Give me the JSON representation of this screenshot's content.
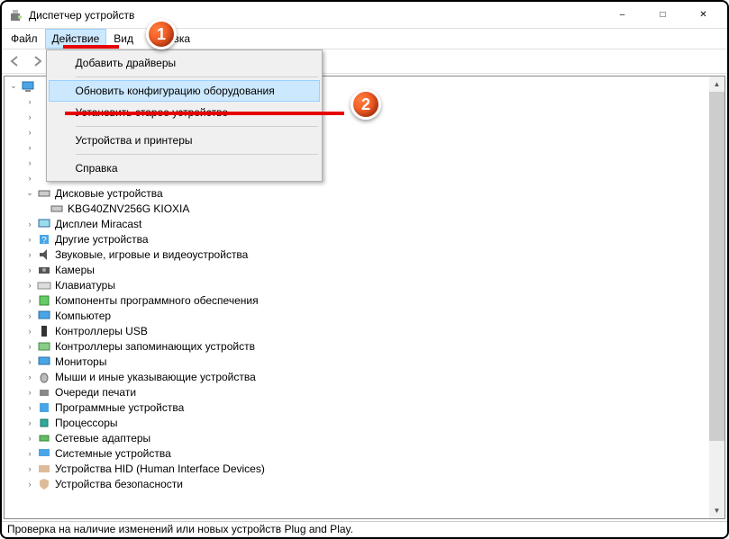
{
  "window": {
    "title": "Диспетчер устройств"
  },
  "menubar": {
    "file": "Файл",
    "action": "Действие",
    "view": "Вид",
    "help": "Справка"
  },
  "dropdown": {
    "add_drivers": "Добавить драйверы",
    "scan": "Обновить конфигурацию оборудования",
    "add_legacy": "Установить старое устройство",
    "devices_printers": "Устройства и принтеры",
    "help": "Справка"
  },
  "tree": {
    "disk_drives": "Дисковые устройства",
    "disk_item": "KBG40ZNV256G KIOXIA",
    "miracast": "Дисплеи Miracast",
    "other": "Другие устройства",
    "audio": "Звуковые, игровые и видеоустройства",
    "cameras": "Камеры",
    "keyboards": "Клавиатуры",
    "software": "Компоненты программного обеспечения",
    "computer": "Компьютер",
    "usb": "Контроллеры USB",
    "storage": "Контроллеры запоминающих устройств",
    "monitors": "Мониторы",
    "mice": "Мыши и иные указывающие устройства",
    "print": "Очереди печати",
    "softdev": "Программные устройства",
    "cpu": "Процессоры",
    "network": "Сетевые адаптеры",
    "system": "Системные устройства",
    "hid": "Устройства HID (Human Interface Devices)",
    "security": "Устройства безопасности"
  },
  "statusbar": {
    "text": "Проверка на наличие изменений или новых устройств Plug and Play."
  },
  "callouts": {
    "one": "1",
    "two": "2"
  }
}
